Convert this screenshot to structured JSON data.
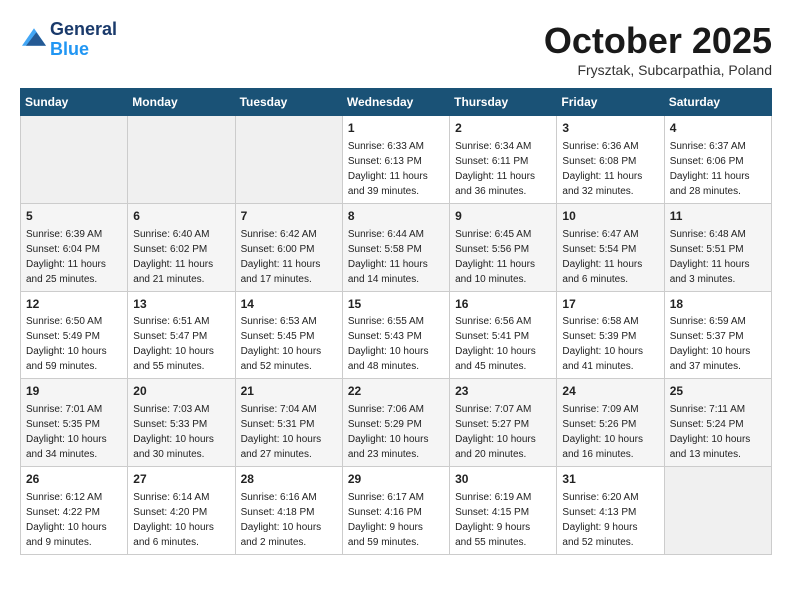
{
  "header": {
    "logo_line1": "General",
    "logo_line2": "Blue",
    "month": "October 2025",
    "location": "Frysztak, Subcarpathia, Poland"
  },
  "days_of_week": [
    "Sunday",
    "Monday",
    "Tuesday",
    "Wednesday",
    "Thursday",
    "Friday",
    "Saturday"
  ],
  "weeks": [
    [
      {
        "day": "",
        "info": ""
      },
      {
        "day": "",
        "info": ""
      },
      {
        "day": "",
        "info": ""
      },
      {
        "day": "1",
        "info": "Sunrise: 6:33 AM\nSunset: 6:13 PM\nDaylight: 11 hours\nand 39 minutes."
      },
      {
        "day": "2",
        "info": "Sunrise: 6:34 AM\nSunset: 6:11 PM\nDaylight: 11 hours\nand 36 minutes."
      },
      {
        "day": "3",
        "info": "Sunrise: 6:36 AM\nSunset: 6:08 PM\nDaylight: 11 hours\nand 32 minutes."
      },
      {
        "day": "4",
        "info": "Sunrise: 6:37 AM\nSunset: 6:06 PM\nDaylight: 11 hours\nand 28 minutes."
      }
    ],
    [
      {
        "day": "5",
        "info": "Sunrise: 6:39 AM\nSunset: 6:04 PM\nDaylight: 11 hours\nand 25 minutes."
      },
      {
        "day": "6",
        "info": "Sunrise: 6:40 AM\nSunset: 6:02 PM\nDaylight: 11 hours\nand 21 minutes."
      },
      {
        "day": "7",
        "info": "Sunrise: 6:42 AM\nSunset: 6:00 PM\nDaylight: 11 hours\nand 17 minutes."
      },
      {
        "day": "8",
        "info": "Sunrise: 6:44 AM\nSunset: 5:58 PM\nDaylight: 11 hours\nand 14 minutes."
      },
      {
        "day": "9",
        "info": "Sunrise: 6:45 AM\nSunset: 5:56 PM\nDaylight: 11 hours\nand 10 minutes."
      },
      {
        "day": "10",
        "info": "Sunrise: 6:47 AM\nSunset: 5:54 PM\nDaylight: 11 hours\nand 6 minutes."
      },
      {
        "day": "11",
        "info": "Sunrise: 6:48 AM\nSunset: 5:51 PM\nDaylight: 11 hours\nand 3 minutes."
      }
    ],
    [
      {
        "day": "12",
        "info": "Sunrise: 6:50 AM\nSunset: 5:49 PM\nDaylight: 10 hours\nand 59 minutes."
      },
      {
        "day": "13",
        "info": "Sunrise: 6:51 AM\nSunset: 5:47 PM\nDaylight: 10 hours\nand 55 minutes."
      },
      {
        "day": "14",
        "info": "Sunrise: 6:53 AM\nSunset: 5:45 PM\nDaylight: 10 hours\nand 52 minutes."
      },
      {
        "day": "15",
        "info": "Sunrise: 6:55 AM\nSunset: 5:43 PM\nDaylight: 10 hours\nand 48 minutes."
      },
      {
        "day": "16",
        "info": "Sunrise: 6:56 AM\nSunset: 5:41 PM\nDaylight: 10 hours\nand 45 minutes."
      },
      {
        "day": "17",
        "info": "Sunrise: 6:58 AM\nSunset: 5:39 PM\nDaylight: 10 hours\nand 41 minutes."
      },
      {
        "day": "18",
        "info": "Sunrise: 6:59 AM\nSunset: 5:37 PM\nDaylight: 10 hours\nand 37 minutes."
      }
    ],
    [
      {
        "day": "19",
        "info": "Sunrise: 7:01 AM\nSunset: 5:35 PM\nDaylight: 10 hours\nand 34 minutes."
      },
      {
        "day": "20",
        "info": "Sunrise: 7:03 AM\nSunset: 5:33 PM\nDaylight: 10 hours\nand 30 minutes."
      },
      {
        "day": "21",
        "info": "Sunrise: 7:04 AM\nSunset: 5:31 PM\nDaylight: 10 hours\nand 27 minutes."
      },
      {
        "day": "22",
        "info": "Sunrise: 7:06 AM\nSunset: 5:29 PM\nDaylight: 10 hours\nand 23 minutes."
      },
      {
        "day": "23",
        "info": "Sunrise: 7:07 AM\nSunset: 5:27 PM\nDaylight: 10 hours\nand 20 minutes."
      },
      {
        "day": "24",
        "info": "Sunrise: 7:09 AM\nSunset: 5:26 PM\nDaylight: 10 hours\nand 16 minutes."
      },
      {
        "day": "25",
        "info": "Sunrise: 7:11 AM\nSunset: 5:24 PM\nDaylight: 10 hours\nand 13 minutes."
      }
    ],
    [
      {
        "day": "26",
        "info": "Sunrise: 6:12 AM\nSunset: 4:22 PM\nDaylight: 10 hours\nand 9 minutes."
      },
      {
        "day": "27",
        "info": "Sunrise: 6:14 AM\nSunset: 4:20 PM\nDaylight: 10 hours\nand 6 minutes."
      },
      {
        "day": "28",
        "info": "Sunrise: 6:16 AM\nSunset: 4:18 PM\nDaylight: 10 hours\nand 2 minutes."
      },
      {
        "day": "29",
        "info": "Sunrise: 6:17 AM\nSunset: 4:16 PM\nDaylight: 9 hours\nand 59 minutes."
      },
      {
        "day": "30",
        "info": "Sunrise: 6:19 AM\nSunset: 4:15 PM\nDaylight: 9 hours\nand 55 minutes."
      },
      {
        "day": "31",
        "info": "Sunrise: 6:20 AM\nSunset: 4:13 PM\nDaylight: 9 hours\nand 52 minutes."
      },
      {
        "day": "",
        "info": ""
      }
    ]
  ]
}
